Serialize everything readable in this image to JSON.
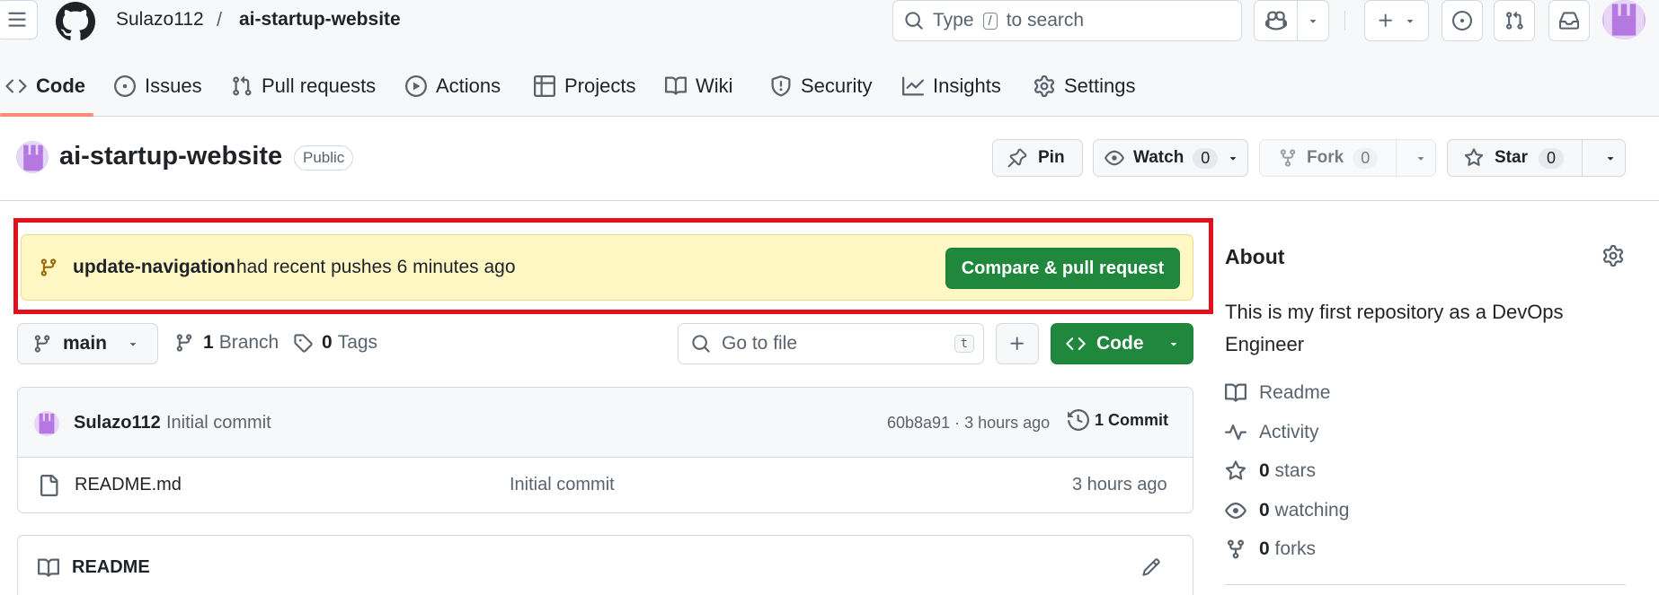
{
  "header": {
    "owner": "Sulazo112",
    "separator": "/",
    "repo": "ai-startup-website",
    "search_prefix": "Type",
    "search_key": "/",
    "search_suffix": "to search"
  },
  "tabs": [
    {
      "label": "Code",
      "icon": "code-icon",
      "active": true
    },
    {
      "label": "Issues",
      "icon": "issue-opened-icon"
    },
    {
      "label": "Pull requests",
      "icon": "git-pull-request-icon"
    },
    {
      "label": "Actions",
      "icon": "play-icon"
    },
    {
      "label": "Projects",
      "icon": "table-icon"
    },
    {
      "label": "Wiki",
      "icon": "book-icon"
    },
    {
      "label": "Security",
      "icon": "shield-icon"
    },
    {
      "label": "Insights",
      "icon": "graph-icon"
    },
    {
      "label": "Settings",
      "icon": "gear-icon"
    }
  ],
  "repo_header": {
    "name": "ai-startup-website",
    "visibility": "Public",
    "pin_label": "Pin",
    "watch_label": "Watch",
    "watch_count": "0",
    "fork_label": "Fork",
    "fork_count": "0",
    "star_label": "Star",
    "star_count": "0"
  },
  "banner": {
    "branch": "update-navigation",
    "message": "had recent pushes 6 minutes ago",
    "button_label": "Compare & pull request",
    "highlight_color": "#e0111b"
  },
  "toolbar": {
    "branch_label": "main",
    "branches_count": "1",
    "branches_label": "Branch",
    "tags_count": "0",
    "tags_label": "Tags",
    "goto_placeholder": "Go to file",
    "goto_key": "t",
    "add_label": "+",
    "code_label": "Code"
  },
  "commit": {
    "author": "Sulazo112",
    "message": "Initial commit",
    "hash_time": "60b8a91 · 3 hours ago",
    "commits_label": "1 Commit"
  },
  "files": [
    {
      "name": "README.md",
      "message": "Initial commit",
      "time": "3 hours ago"
    }
  ],
  "readme": {
    "title": "README"
  },
  "about": {
    "title": "About",
    "description": "This is my first repository as a DevOps Engineer",
    "readme": "Readme",
    "activity": "Activity",
    "stars_count": "0",
    "stars_label": "stars",
    "watching_count": "0",
    "watching_label": "watching",
    "forks_count": "0",
    "forks_label": "forks"
  },
  "colors": {
    "accent_green": "#1f883d",
    "active_tab_underline": "#fd8c73",
    "banner_bg": "#fff8c5"
  }
}
